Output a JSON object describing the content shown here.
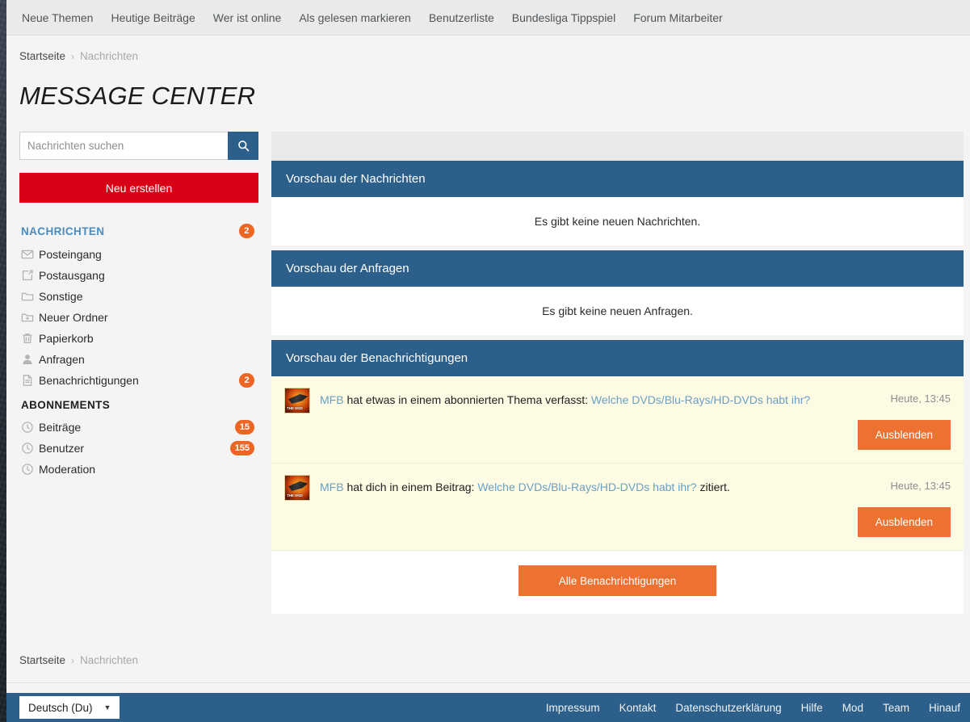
{
  "topnav": {
    "items": [
      {
        "label": "Neue Themen"
      },
      {
        "label": "Heutige Beiträge"
      },
      {
        "label": "Wer ist online"
      },
      {
        "label": "Als gelesen markieren"
      },
      {
        "label": "Benutzerliste"
      },
      {
        "label": "Bundesliga Tippspiel"
      },
      {
        "label": "Forum Mitarbeiter"
      }
    ]
  },
  "breadcrumb": {
    "home": "Startseite",
    "separator": "›",
    "current": "Nachrichten"
  },
  "page_title": "MESSAGE CENTER",
  "sidebar": {
    "search": {
      "placeholder": "Nachrichten suchen",
      "value": "",
      "icon": "search-icon"
    },
    "new_button": "Neu erstellen",
    "sections": [
      {
        "heading": "NACHRICHTEN",
        "heading_badge": "2",
        "items": [
          {
            "label": "Posteingang",
            "icon": "envelope-icon",
            "badge": ""
          },
          {
            "label": "Postausgang",
            "icon": "share-out-icon",
            "badge": ""
          },
          {
            "label": "Sonstige",
            "icon": "folder-icon",
            "badge": ""
          },
          {
            "label": "Neuer Ordner",
            "icon": "folder-plus-icon",
            "badge": ""
          },
          {
            "label": "Papierkorb",
            "icon": "trash-icon",
            "badge": ""
          },
          {
            "label": "Anfragen",
            "icon": "user-icon",
            "badge": ""
          },
          {
            "label": "Benachrichtigungen",
            "icon": "document-icon",
            "badge": "2"
          }
        ]
      },
      {
        "heading": "ABONNEMENTS",
        "heading_badge": "",
        "items": [
          {
            "label": "Beiträge",
            "icon": "clock-icon",
            "badge": "15"
          },
          {
            "label": "Benutzer",
            "icon": "clock-icon",
            "badge": "155"
          },
          {
            "label": "Moderation",
            "icon": "clock-icon",
            "badge": ""
          }
        ]
      }
    ]
  },
  "main": {
    "messages_panel": {
      "title": "Vorschau der Nachrichten",
      "empty_text": "Es gibt keine neuen Nachrichten."
    },
    "requests_panel": {
      "title": "Vorschau der Anfragen",
      "empty_text": "Es gibt keine neuen Anfragen."
    },
    "notifications_panel": {
      "title": "Vorschau der Benachrichtigungen",
      "rows": [
        {
          "user": "MFB",
          "text_before": " hat etwas in einem abonnierten Thema verfasst: ",
          "link": "Welche DVDs/Blu-Rays/HD-DVDs habt ihr?",
          "text_after": "",
          "time": "Heute, 13:45",
          "action": "Ausblenden"
        },
        {
          "user": "MFB",
          "text_before": " hat dich in einem Beitrag: ",
          "link": "Welche DVDs/Blu-Rays/HD-DVDs habt ihr?",
          "text_after": " zitiert.",
          "time": "Heute, 13:45",
          "action": "Ausblenden"
        }
      ],
      "all_button": "Alle Benachrichtigungen"
    }
  },
  "footer": {
    "language": "Deutsch (Du)",
    "caret": "▼",
    "links": [
      {
        "label": "Impressum"
      },
      {
        "label": "Kontakt"
      },
      {
        "label": "Datenschutzerklärung"
      },
      {
        "label": "Hilfe"
      },
      {
        "label": "Mod"
      },
      {
        "label": "Team"
      },
      {
        "label": "Hinauf"
      }
    ]
  },
  "colors": {
    "panel_blue": "#2d5f8b",
    "accent_red": "#d80017",
    "accent_orange": "#ed7231",
    "badge_orange": "#ed6623",
    "link_blue": "#6a9fc4",
    "heading_blue": "#4a8cc0"
  }
}
